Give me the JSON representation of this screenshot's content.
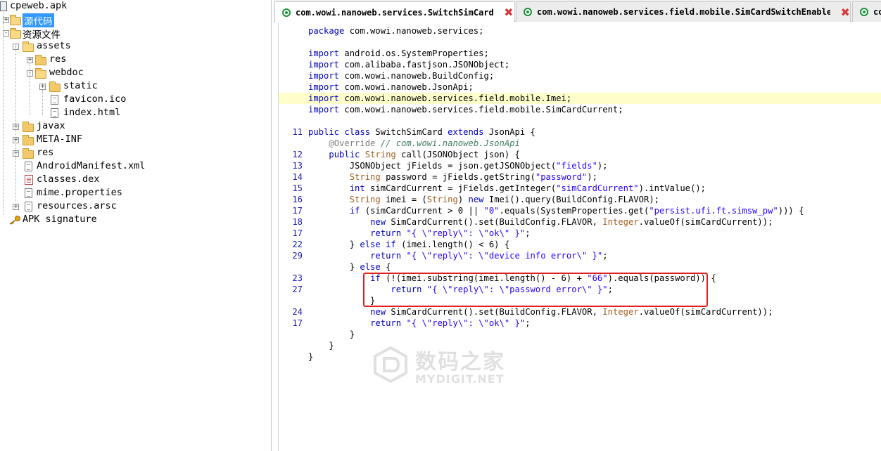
{
  "tree": {
    "items": [
      {
        "label": "cpeweb.apk",
        "icon": "apk-icon",
        "level": 0
      },
      {
        "label": "源代码",
        "icon": "folder-icon",
        "level": 0,
        "selected": true
      },
      {
        "label": "资源文件",
        "icon": "folder-icon",
        "level": 0
      },
      {
        "label": "assets",
        "icon": "folder-icon",
        "level": 1
      },
      {
        "label": "res",
        "icon": "folder-icon",
        "level": 2
      },
      {
        "label": "webdoc",
        "icon": "folder-icon",
        "level": 2
      },
      {
        "label": "static",
        "icon": "folder-icon",
        "level": 3
      },
      {
        "label": "favicon.ico",
        "icon": "file-icon",
        "level": 3
      },
      {
        "label": "index.html",
        "icon": "file-icon",
        "level": 3
      },
      {
        "label": "javax",
        "icon": "folder-icon",
        "level": 1
      },
      {
        "label": "META-INF",
        "icon": "folder-icon",
        "level": 1
      },
      {
        "label": "res",
        "icon": "folder-icon",
        "level": 1
      },
      {
        "label": "AndroidManifest.xml",
        "icon": "file-icon",
        "level": 1
      },
      {
        "label": "classes.dex",
        "icon": "dex-icon",
        "level": 1
      },
      {
        "label": "mime.properties",
        "icon": "file-icon",
        "level": 1
      },
      {
        "label": "resources.arsc",
        "icon": "file-icon",
        "level": 1
      },
      {
        "label": "APK signature",
        "icon": "key-icon",
        "level": 0
      }
    ]
  },
  "tabs": [
    {
      "label": "com.wowi.nanoweb.services.SwitchSimCard",
      "active": true
    },
    {
      "label": "com.wowi.nanoweb.services.field.mobile.SimCardSwitchEnabled",
      "active": false
    },
    {
      "label": "co",
      "active": false
    }
  ],
  "editor": {
    "highlight_line": 7,
    "lines": [
      {
        "n": "",
        "t": "package com.wowi.nanoweb.services;"
      },
      {
        "n": "",
        "t": ""
      },
      {
        "n": "",
        "t": "import android.os.SystemProperties;"
      },
      {
        "n": "",
        "t": "import com.alibaba.fastjson.JSONObject;"
      },
      {
        "n": "",
        "t": "import com.wowi.nanoweb.BuildConfig;"
      },
      {
        "n": "",
        "t": "import com.wowi.nanoweb.JsonApi;"
      },
      {
        "n": "",
        "t": "import com.wowi.nanoweb.services.field.mobile.Imei;"
      },
      {
        "n": "",
        "t": "import com.wowi.nanoweb.services.field.mobile.SimCardCurrent;"
      },
      {
        "n": "",
        "t": ""
      },
      {
        "n": "11",
        "t": "public class SwitchSimCard extends JsonApi {"
      },
      {
        "n": "",
        "t": "    @Override // com.wowi.nanoweb.JsonApi"
      },
      {
        "n": "12",
        "t": "    public String call(JSONObject json) {"
      },
      {
        "n": "13",
        "t": "        JSONObject jFields = json.getJSONObject(\"fields\");"
      },
      {
        "n": "14",
        "t": "        String password = jFields.getString(\"password\");"
      },
      {
        "n": "15",
        "t": "        int simCardCurrent = jFields.getInteger(\"simCardCurrent\").intValue();"
      },
      {
        "n": "16",
        "t": "        String imei = (String) new Imei().query(BuildConfig.FLAVOR);"
      },
      {
        "n": "17",
        "t": "        if (simCardCurrent > 0 || \"0\".equals(SystemProperties.get(\"persist.ufi.ft.simsw_pw\"))) {"
      },
      {
        "n": "18",
        "t": "            new SimCardCurrent().set(BuildConfig.FLAVOR, Integer.valueOf(simCardCurrent));"
      },
      {
        "n": "17",
        "t": "            return \"{ \\\"reply\\\": \\\"ok\\\" }\";"
      },
      {
        "n": "22",
        "t": "        } else if (imei.length() < 6) {"
      },
      {
        "n": "29",
        "t": "            return \"{ \\\"reply\\\": \\\"device info error\\\" }\";"
      },
      {
        "n": "",
        "t": "        } else {"
      },
      {
        "n": "23",
        "t": "            if (!(imei.substring(imei.length() - 6) + \"66\").equals(password)) {"
      },
      {
        "n": "27",
        "t": "                return \"{ \\\"reply\\\": \\\"password error\\\" }\";"
      },
      {
        "n": "",
        "t": "            }"
      },
      {
        "n": "24",
        "t": "            new SimCardCurrent().set(BuildConfig.FLAVOR, Integer.valueOf(simCardCurrent));"
      },
      {
        "n": "17",
        "t": "            return \"{ \\\"reply\\\": \\\"ok\\\" }\";"
      },
      {
        "n": "",
        "t": "        }"
      },
      {
        "n": "",
        "t": "    }"
      },
      {
        "n": "",
        "t": "}"
      }
    ]
  },
  "annotation": {
    "color": "#e02020"
  },
  "watermark": {
    "cn": "数码之家",
    "en": "MYDIGIT.NET"
  }
}
